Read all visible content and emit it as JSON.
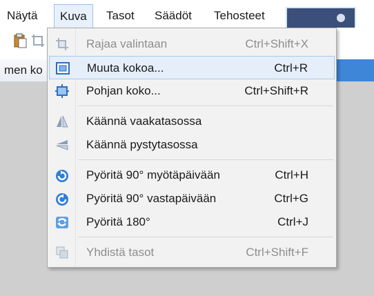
{
  "menubar": {
    "items": [
      {
        "label": "Näytä"
      },
      {
        "label": "Kuva"
      },
      {
        "label": "Tasot"
      },
      {
        "label": "Säädöt"
      },
      {
        "label": "Tehosteet"
      }
    ],
    "active_index": 1
  },
  "tabrow": {
    "label": "men ko"
  },
  "menu": {
    "items": [
      {
        "label": "Rajaa valintaan",
        "shortcut": "Ctrl+Shift+X",
        "icon": "crop-icon",
        "enabled": false,
        "highlighted": false
      },
      {
        "label": "Muuta kokoa...",
        "shortcut": "Ctrl+R",
        "icon": "resize-image-icon",
        "enabled": true,
        "highlighted": true
      },
      {
        "label": "Pohjan koko...",
        "shortcut": "Ctrl+Shift+R",
        "icon": "canvas-size-icon",
        "enabled": true,
        "highlighted": false
      },
      {
        "label": "Käännä vaakatasossa",
        "shortcut": "",
        "icon": "flip-horizontal-icon",
        "enabled": true,
        "highlighted": false
      },
      {
        "label": "Käännä pystytasossa",
        "shortcut": "",
        "icon": "flip-vertical-icon",
        "enabled": true,
        "highlighted": false
      },
      {
        "label": "Pyöritä 90° myötäpäivään",
        "shortcut": "Ctrl+H",
        "icon": "rotate-clockwise-icon",
        "enabled": true,
        "highlighted": false
      },
      {
        "label": "Pyöritä 90° vastapäivään",
        "shortcut": "Ctrl+G",
        "icon": "rotate-counterclockwise-icon",
        "enabled": true,
        "highlighted": false
      },
      {
        "label": "Pyöritä 180°",
        "shortcut": "Ctrl+J",
        "icon": "rotate-180-icon",
        "enabled": true,
        "highlighted": false
      },
      {
        "label": "Yhdistä tasot",
        "shortcut": "Ctrl+Shift+F",
        "icon": "flatten-layers-icon",
        "enabled": false,
        "highlighted": false
      }
    ]
  },
  "colors": {
    "accent": "#3d86d8",
    "highlight_bg": "#e5eef9",
    "highlight_border": "#a8c8ea",
    "workspace": "#cfcfcf"
  }
}
